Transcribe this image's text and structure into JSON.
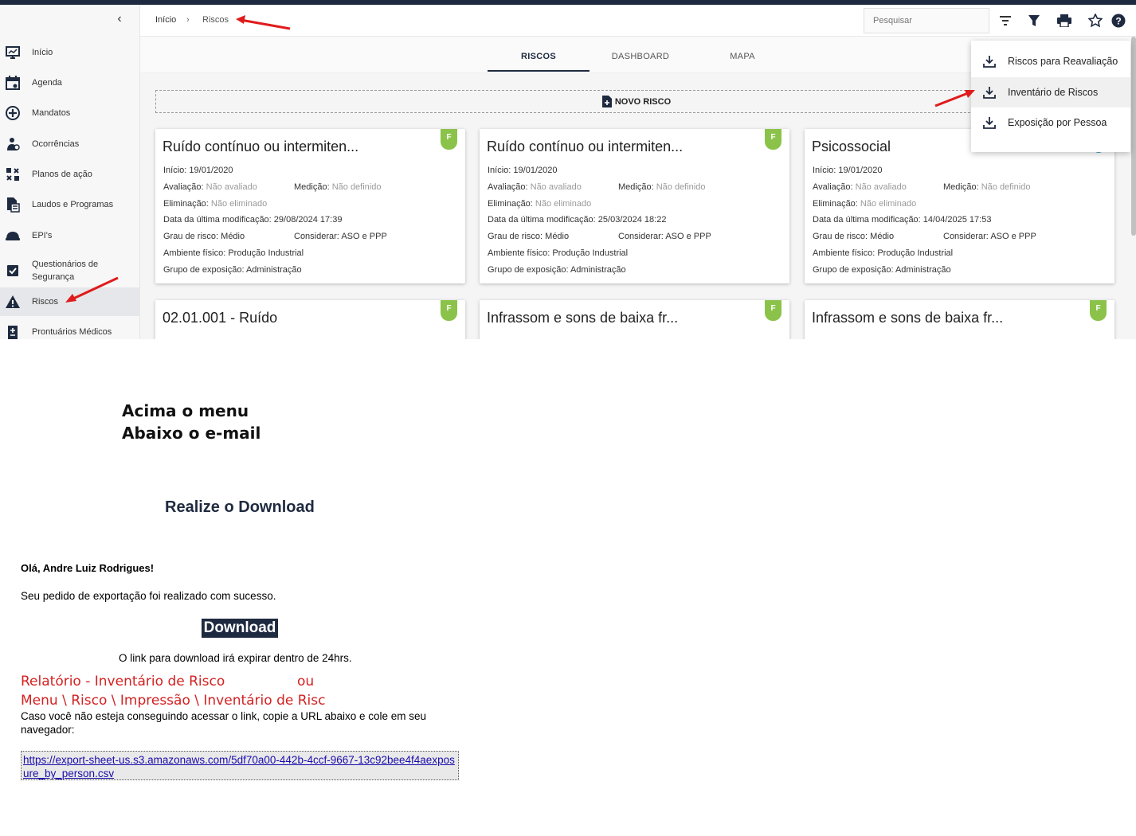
{
  "sidebar": {
    "items": [
      {
        "label": "Início",
        "icon": "dashboard-icon"
      },
      {
        "label": "Agenda",
        "icon": "calendar-icon"
      },
      {
        "label": "Mandatos",
        "icon": "plus-circle-icon"
      },
      {
        "label": "Ocorrências",
        "icon": "person-alert-icon"
      },
      {
        "label": "Planos de ação",
        "icon": "action-plan-icon"
      },
      {
        "label": "Laudos e Programas",
        "icon": "document-icon"
      },
      {
        "label": "EPI's",
        "icon": "helmet-icon"
      },
      {
        "label": "Questionários de Segurança",
        "icon": "checkbox-icon"
      },
      {
        "label": "Riscos",
        "icon": "warning-icon"
      },
      {
        "label": "Prontuários Médicos",
        "icon": "medical-record-icon"
      }
    ]
  },
  "breadcrumb": {
    "home": "Início",
    "current": "Riscos"
  },
  "search": {
    "placeholder": "Pesquisar"
  },
  "tabs": [
    "RISCOS",
    "DASHBOARD",
    "MAPA"
  ],
  "new_risk_label": "NOVO RISCO",
  "dropdown": {
    "items": [
      "Riscos para Reavaliação",
      "Inventário de Riscos",
      "Exposição por Pessoa"
    ]
  },
  "labels": {
    "inicio": "Início:",
    "avaliacao": "Avaliação:",
    "medicao": "Medição:",
    "eliminacao": "Eliminação:",
    "ultima_mod": "Data da última modificação:",
    "grau": "Grau de risco:",
    "considerar": "Considerar:",
    "ambiente": "Ambiente físico:",
    "grupo": "Grupo de exposição:"
  },
  "cards": [
    {
      "title": "Ruído contínuo ou intermiten...",
      "badge": "F",
      "inicio": "19/01/2020",
      "avaliacao": "Não avaliado",
      "medicao": "Não definido",
      "eliminacao": "Não eliminado",
      "ultima_mod": "29/08/2024 17:39",
      "grau": "Médio",
      "considerar": "ASO e PPP",
      "ambiente": "Produção Industrial",
      "grupo": "Administração"
    },
    {
      "title": "Ruído contínuo ou intermiten...",
      "badge": "F",
      "inicio": "19/01/2020",
      "avaliacao": "Não avaliado",
      "medicao": "Não definido",
      "eliminacao": "Não eliminado",
      "ultima_mod": "25/03/2024 18:22",
      "grau": "Médio",
      "considerar": "ASO e PPP",
      "ambiente": "Produção Industrial",
      "grupo": "Administração"
    },
    {
      "title": "Psicossocial",
      "badge": "",
      "inicio": "19/01/2020",
      "avaliacao": "Não avaliado",
      "medicao": "Não definido",
      "eliminacao": "Não eliminado",
      "ultima_mod": "14/04/2025 17:53",
      "grau": "Médio",
      "considerar": "ASO e PPP",
      "ambiente": "Produção Industrial",
      "grupo": "Administração"
    },
    {
      "title": "02.01.001 - Ruído",
      "badge": "F"
    },
    {
      "title": "Infrassom e sons de baixa fr...",
      "badge": "F"
    },
    {
      "title": "Infrassom e sons de baixa fr...",
      "badge": "F"
    }
  ],
  "annotation": {
    "line1": "Acima o menu",
    "line2": "Abaixo o e-mail"
  },
  "email": {
    "heading": "Realize o Download",
    "greeting": "Olá, Andre Luiz Rodrigues!",
    "success": "Seu pedido de exportação foi realizado com sucesso.",
    "download": "Download",
    "expire": "O link para download irá expirar dentro de 24hrs.",
    "red1": "Relatório - Inventário de Risco",
    "red1b": "ou",
    "red2": "Menu \\ Risco \\ Impressão \\ Inventário de Risc",
    "fallback": "Caso você não esteja conseguindo acessar o link, copie a URL abaixo e cole em seu navegador:",
    "url": "https://export-sheet-us.s3.amazonaws.com/5df70a00-442b-4ccf-9667-13c92bee4f4aexposure_by_person.csv"
  }
}
